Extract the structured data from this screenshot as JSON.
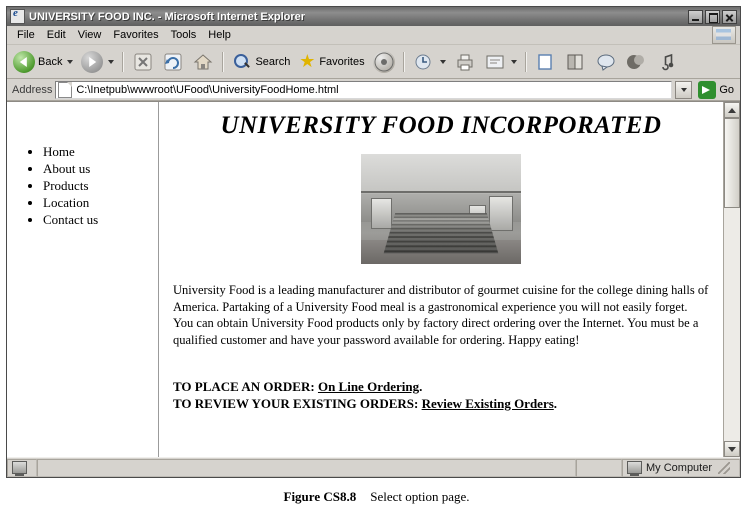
{
  "window": {
    "title": "UNIVERSITY FOOD INC. - Microsoft Internet Explorer",
    "app_icon": "ie-logo-icon",
    "buttons": {
      "minimize": "minimize-button",
      "maximize": "maximize-button",
      "close": "close-button"
    }
  },
  "menubar": {
    "items": [
      "File",
      "Edit",
      "View",
      "Favorites",
      "Tools",
      "Help"
    ]
  },
  "toolbar": {
    "back": "Back",
    "forward": "",
    "stop": "",
    "refresh": "",
    "home": "",
    "search": "Search",
    "favorites": "Favorites",
    "media": "",
    "history": "",
    "mail": "",
    "print": "",
    "edit": "",
    "discuss": "",
    "research": "",
    "messenger": "",
    "realone": "",
    "other": ""
  },
  "address": {
    "label": "Address",
    "value": "C:\\Inetpub\\wwwroot\\UFood\\UniversityFoodHome.html",
    "go_label": "Go"
  },
  "page": {
    "heading": "UNIVERSITY FOOD INCORPORATED",
    "nav": [
      "Home",
      "About us",
      "Products",
      "Location",
      "Contact us"
    ],
    "image_alt": "food-processing-plant-photo",
    "paragraph": "University Food is a leading manufacturer and distributor of gourmet cuisine for the college dining halls of America. Partaking of a University Food meal is a gastronomical experience you will not easily forget. You can obtain University Food products only by factory direct ordering over the Internet. You must be a qualified customer and have your password available for ordering. Happy eating!",
    "order_line_label": "TO PLACE AN ORDER:",
    "order_line_link": "On Line Ordering",
    "order_line_end": ".",
    "review_line_label": "TO REVIEW YOUR EXISTING ORDERS:",
    "review_line_link": "Review Existing Orders",
    "review_line_end": "."
  },
  "statusbar": {
    "message": "",
    "zone": "My Computer"
  },
  "caption": {
    "figure": "Figure CS8.8",
    "text": "Select option page."
  }
}
